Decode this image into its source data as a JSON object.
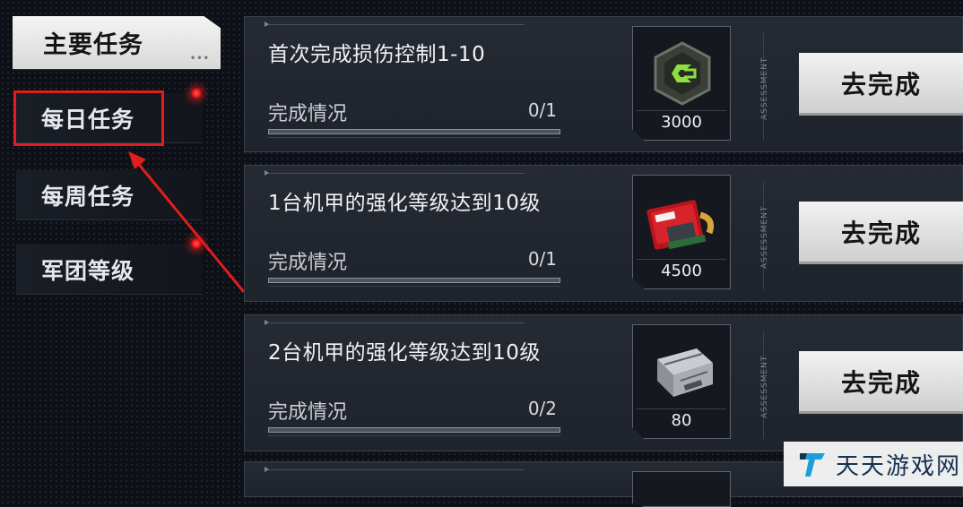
{
  "sidebar": {
    "primary_tab": "主要任务",
    "tabs": [
      {
        "label": "每日任务",
        "has_alert": true,
        "highlighted": true
      },
      {
        "label": "每周任务",
        "has_alert": false,
        "highlighted": false
      },
      {
        "label": "军团等级",
        "has_alert": true,
        "highlighted": false
      }
    ]
  },
  "tasks": [
    {
      "title": "首次完成损伤控制1-10",
      "progress_label": "完成情况",
      "progress_text": "0/1",
      "progress": 0,
      "reward_icon": "hex-chip-icon",
      "reward_amount": "3000",
      "side_label": "ASSESSMENT",
      "button": "去完成"
    },
    {
      "title": "1台机甲的强化等级达到10级",
      "progress_label": "完成情况",
      "progress_text": "0/1",
      "progress": 0,
      "reward_icon": "data-module-icon",
      "reward_amount": "4500",
      "side_label": "ASSESSMENT",
      "button": "去完成"
    },
    {
      "title": "2台机甲的强化等级达到10级",
      "progress_label": "完成情况",
      "progress_text": "0/2",
      "progress": 0,
      "reward_icon": "metal-crate-icon",
      "reward_amount": "80",
      "side_label": "ASSESSMENT",
      "button": "去完成"
    }
  ],
  "watermark": {
    "text": "天天游戏网"
  },
  "colors": {
    "accent_red": "#e21d1d",
    "button_bg": "#e8e8e8",
    "panel_bg": "#232831"
  }
}
